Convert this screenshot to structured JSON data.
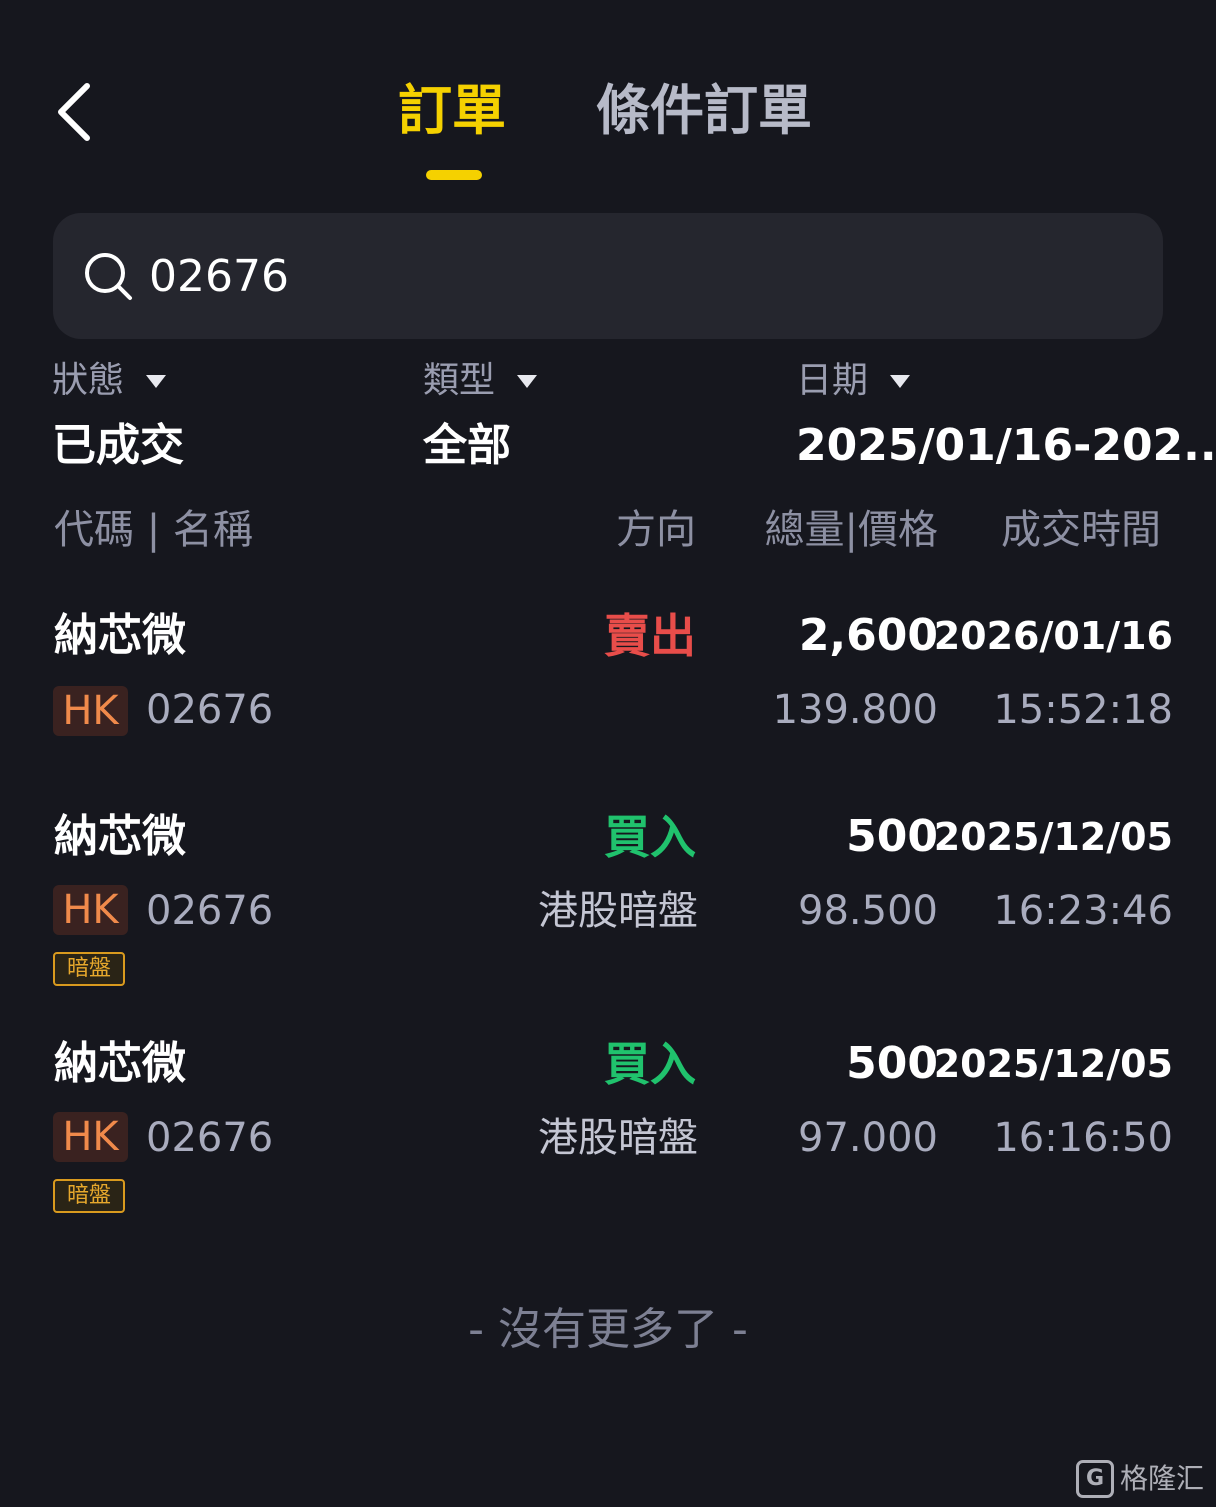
{
  "header": {
    "tabs": [
      {
        "label": "訂單",
        "active": true
      },
      {
        "label": "條件訂單",
        "active": false
      }
    ]
  },
  "search": {
    "value": "02676",
    "icon": "search-icon"
  },
  "filters": [
    {
      "label": "狀態",
      "value": "已成交"
    },
    {
      "label": "類型",
      "value": "全部"
    },
    {
      "label": "日期",
      "value": "2025/01/16-202..."
    }
  ],
  "columns": {
    "name": "代碼 | 名稱",
    "direction": "方向",
    "qty_price": "總量|價格",
    "time": "成交時間"
  },
  "orders": [
    {
      "name": "納芯微",
      "market_badge": "HK",
      "code": "02676",
      "direction": "賣出",
      "direction_type": "sell",
      "market": "",
      "quantity": "2,600",
      "price": "139.800",
      "date": "2026/01/16",
      "time": "15:52:18",
      "tag": ""
    },
    {
      "name": "納芯微",
      "market_badge": "HK",
      "code": "02676",
      "direction": "買入",
      "direction_type": "buy",
      "market": "港股暗盤",
      "quantity": "500",
      "price": "98.500",
      "date": "2025/12/05",
      "time": "16:23:46",
      "tag": "暗盤"
    },
    {
      "name": "納芯微",
      "market_badge": "HK",
      "code": "02676",
      "direction": "買入",
      "direction_type": "buy",
      "market": "港股暗盤",
      "quantity": "500",
      "price": "97.000",
      "date": "2025/12/05",
      "time": "16:16:50",
      "tag": "暗盤"
    }
  ],
  "footer": {
    "text": "- 沒有更多了 -"
  },
  "watermark": {
    "logo": "G",
    "text": "格隆汇"
  },
  "colors": {
    "background": "#16171e",
    "accent": "#f5d100",
    "sell": "#e84d4a",
    "buy": "#20c26d",
    "badge": "#f08a4b"
  }
}
